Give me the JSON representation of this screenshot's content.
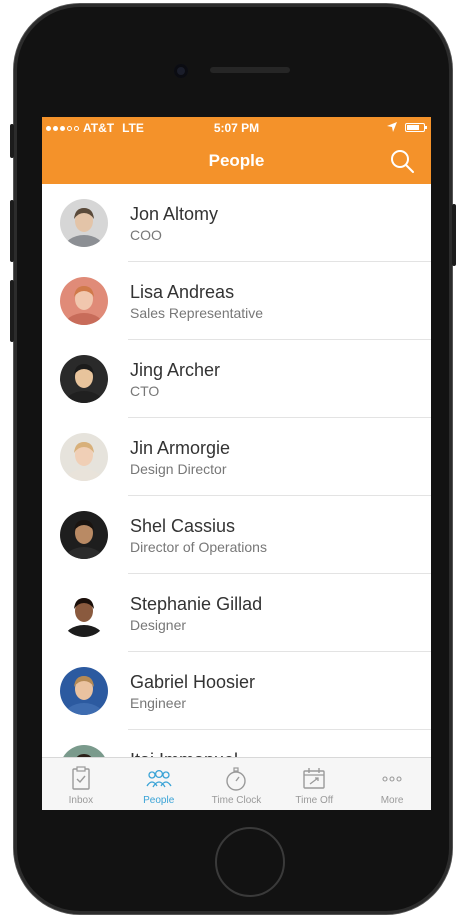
{
  "status_bar": {
    "carrier": "AT&T",
    "network": "LTE",
    "time": "5:07 PM"
  },
  "nav": {
    "title": "People"
  },
  "people": [
    {
      "name": "Jon Altomy",
      "title": "COO",
      "skin": "#e3c4a8",
      "hair": "#5a4a3a",
      "bg": "#d6d6d6",
      "shirt": "#8c8f94"
    },
    {
      "name": "Lisa Andreas",
      "title": "Sales Representative",
      "skin": "#f1c7ae",
      "hair": "#d07a4a",
      "bg": "#e08b78",
      "shirt": "#c86c5a"
    },
    {
      "name": "Jing Archer",
      "title": "CTO",
      "skin": "#e8c49c",
      "hair": "#1b1b1b",
      "bg": "#2a2a2a",
      "shirt": "#202020"
    },
    {
      "name": "Jin Armorgie",
      "title": "Design Director",
      "skin": "#f0cfb6",
      "hair": "#d8b07a",
      "bg": "#e6e3dc",
      "shirt": "#e9e3da"
    },
    {
      "name": "Shel Cassius",
      "title": "Director of Operations",
      "skin": "#b98a64",
      "hair": "#1a1410",
      "bg": "#1e1e1e",
      "shirt": "#2c2c2c"
    },
    {
      "name": "Stephanie Gillad",
      "title": "Designer",
      "skin": "#8a5a3e",
      "hair": "#1a0f0a",
      "bg": "#ffffff",
      "shirt": "#1c1c1c"
    },
    {
      "name": "Gabriel Hoosier",
      "title": "Engineer",
      "skin": "#eac2a0",
      "hair": "#b58a55",
      "bg": "#2c5aa0",
      "shirt": "#3e6cb0"
    },
    {
      "name": "Itai Immanuel",
      "title": "",
      "skin": "#d8b08a",
      "hair": "#2a1f18",
      "bg": "#7a9a8c",
      "shirt": "#556"
    }
  ],
  "tabs": [
    {
      "label": "Inbox",
      "icon": "inbox-icon",
      "active": false
    },
    {
      "label": "People",
      "icon": "people-icon",
      "active": true
    },
    {
      "label": "Time Clock",
      "icon": "stopwatch-icon",
      "active": false
    },
    {
      "label": "Time Off",
      "icon": "calendar-plane-icon",
      "active": false
    },
    {
      "label": "More",
      "icon": "more-dots-icon",
      "active": false
    }
  ],
  "colors": {
    "header": "#f4922a",
    "active_tab": "#3aa3d6",
    "inactive_tab": "#9a9a9a"
  }
}
